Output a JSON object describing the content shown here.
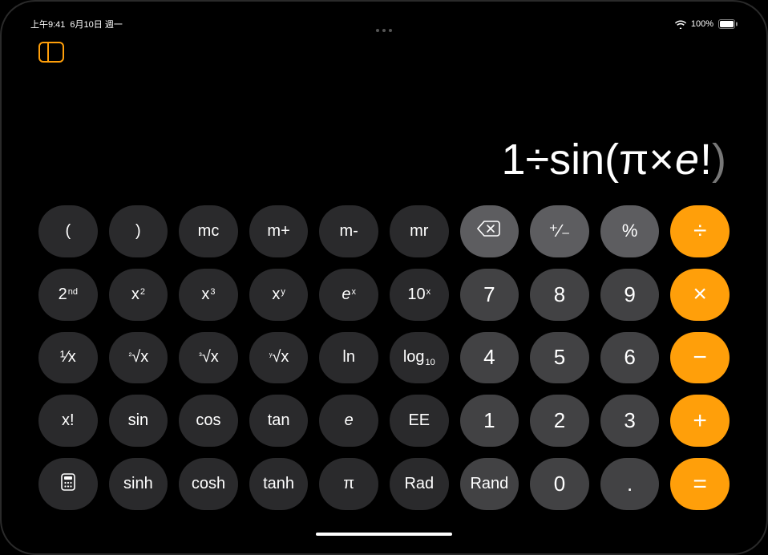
{
  "status": {
    "time": "上午9:41",
    "date": "6月10日 週一",
    "battery_pct": "100%"
  },
  "display": {
    "parts": {
      "a": "1÷sin(π×",
      "b": "e",
      "c": "!",
      "d": ")"
    }
  },
  "keys": {
    "r0": {
      "lparen": "(",
      "rparen": ")",
      "mc": "mc",
      "mplus": "m+",
      "mminus": "m-",
      "mr": "mr",
      "plusminus": "⁺∕₋",
      "percent": "%",
      "divide": "÷"
    },
    "r1": {
      "second_a": "2",
      "second_b": "nd",
      "xsq_a": "x",
      "xsq_b": "2",
      "xcb_a": "x",
      "xcb_b": "3",
      "xy_a": "x",
      "xy_b": "y",
      "ex_a": "e",
      "ex_b": "x",
      "ten_a": "10",
      "ten_b": "x",
      "d7": "7",
      "d8": "8",
      "d9": "9",
      "multiply": "×"
    },
    "r2": {
      "inv_a": "¹∕",
      "inv_b": "x",
      "sqrt_a": "²",
      "sqrt_b": "√x",
      "cbrt_a": "³",
      "cbrt_b": "√x",
      "yrt_a": "ʸ",
      "yrt_b": "√x",
      "ln": "ln",
      "log_a": "log",
      "log_b": "10",
      "d4": "4",
      "d5": "5",
      "d6": "6",
      "minus": "−"
    },
    "r3": {
      "fact": "x!",
      "sin": "sin",
      "cos": "cos",
      "tan": "tan",
      "e": "e",
      "ee": "EE",
      "d1": "1",
      "d2": "2",
      "d3": "3",
      "plus": "+"
    },
    "r4": {
      "sinh": "sinh",
      "cosh": "cosh",
      "tanh": "tanh",
      "pi": "π",
      "rad": "Rad",
      "rand": "Rand",
      "d0": "0",
      "dot": ".",
      "equals": "="
    }
  },
  "icons": {
    "toggle_panel": "panel-toggle-icon",
    "backspace": "backspace-icon",
    "calc_mode": "calculator-mode-icon",
    "wifi": "wifi-icon",
    "battery": "battery-icon"
  }
}
